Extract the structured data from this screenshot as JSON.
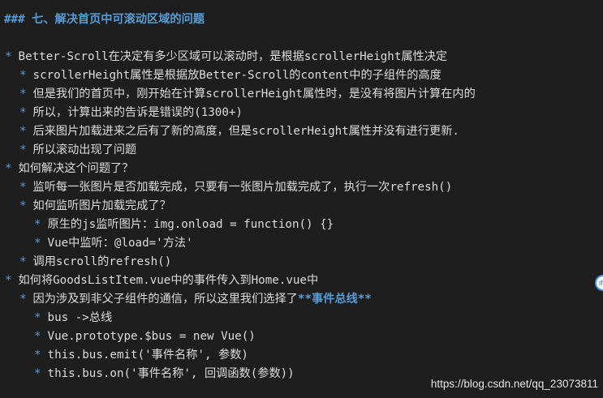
{
  "editor": {
    "heading": "### 七、解决首页中可滚动区域的问题",
    "bullet_char": "*",
    "lines": [
      "Better-Scroll在决定有多少区域可以滚动时，是根据scrollerHeight属性决定",
      "scrollerHeight属性是根据放Better-Scroll的content中的子组件的高度",
      "但是我们的首页中，刚开始在计算scrollerHeight属性时，是没有将图片计算在内的",
      "所以，计算出来的告诉是错误的(1300+)",
      "后来图片加载进来之后有了新的高度，但是scrollerHeight属性并没有进行更新.",
      "所以滚动出现了问题",
      "如何解决这个问题了？",
      "监听每一张图片是否加载完成，只要有一张图片加载完成了，执行一次refresh()",
      "如何监听图片加载完成了？",
      "原生的js监听图片：img.onload = function() {}",
      "Vue中监听：@load='方法'",
      "调用scroll的refresh()",
      "如何将GoodsListItem.vue中的事件传入到Home.vue中",
      "因为涉及到非父子组件的通信，所以这里我们选择了",
      "bus ->总线",
      "Vue.prototype.$bus = new Vue()",
      "this.bus.emit('事件名称', 参数)",
      "this.bus.on('事件名称', 回调函数(参数))"
    ],
    "bold_suffix": "**事件总线**"
  },
  "watermark": "https://blog.csdn.net/qq_23073811",
  "side_badge": "if",
  "colors": {
    "background": "#1e1e1e",
    "text": "#dcdcdc",
    "markdown_accent": "#569cd6"
  }
}
